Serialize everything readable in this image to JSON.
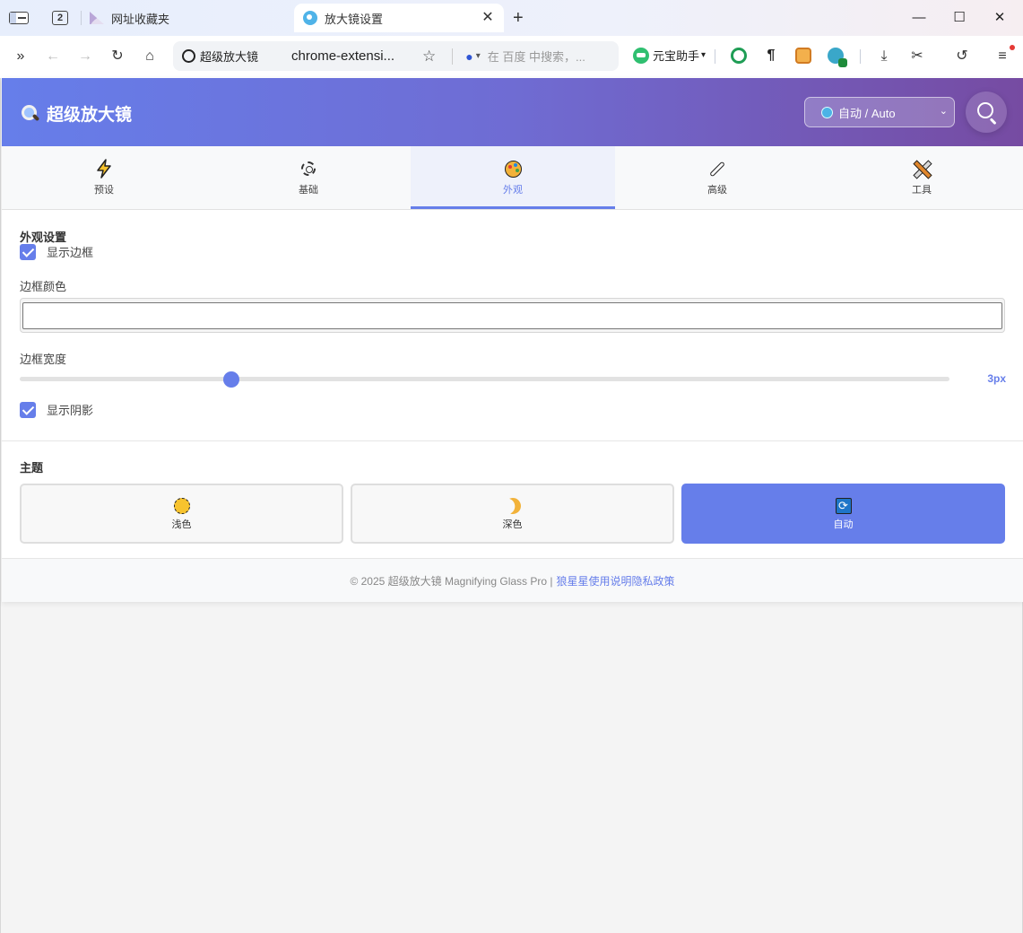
{
  "browser": {
    "tabs": [
      {
        "title": "网址收藏夹",
        "active": false
      },
      {
        "title": "放大镜设置",
        "active": true
      }
    ],
    "tab_count": "2",
    "toolbar": {
      "site_name": "超级放大镜",
      "url": "chrome-extensi...",
      "search_placeholder": "在 百度 中搜索，...",
      "assistant_label": "元宝助手"
    },
    "window_controls": {
      "minimize": "—",
      "maximize": "☐",
      "close": "✕"
    }
  },
  "app": {
    "title": "超级放大镜",
    "language": {
      "selected": "自动 / Auto"
    },
    "accent_color": "#667eea",
    "nav_tabs": [
      {
        "label": "预设",
        "icon": "lightning-icon",
        "active": false
      },
      {
        "label": "基础",
        "icon": "gear-icon",
        "active": false
      },
      {
        "label": "外观",
        "icon": "palette-icon",
        "active": true
      },
      {
        "label": "高级",
        "icon": "wrench-icon",
        "active": false
      },
      {
        "label": "工具",
        "icon": "tools-icon",
        "active": false
      }
    ]
  },
  "appearance": {
    "section_title": "外观设置",
    "show_border": {
      "label": "显示边框",
      "checked": true
    },
    "border_color": {
      "label": "边框颜色",
      "value": ""
    },
    "border_width": {
      "label": "边框宽度",
      "value": "3px",
      "fraction": 0.228
    },
    "show_shadow": {
      "label": "显示阴影",
      "checked": true
    }
  },
  "theme": {
    "section_title": "主题",
    "options": [
      {
        "label": "浅色",
        "icon": "sun-icon",
        "active": false
      },
      {
        "label": "深色",
        "icon": "moon-icon",
        "active": false
      },
      {
        "label": "自动",
        "icon": "sync-icon",
        "active": true
      }
    ]
  },
  "footer": {
    "copyright": "© 2025 超级放大镜 Magnifying Glass Pro |",
    "links": [
      "狼星星",
      "使用说明",
      "隐私政策"
    ]
  }
}
